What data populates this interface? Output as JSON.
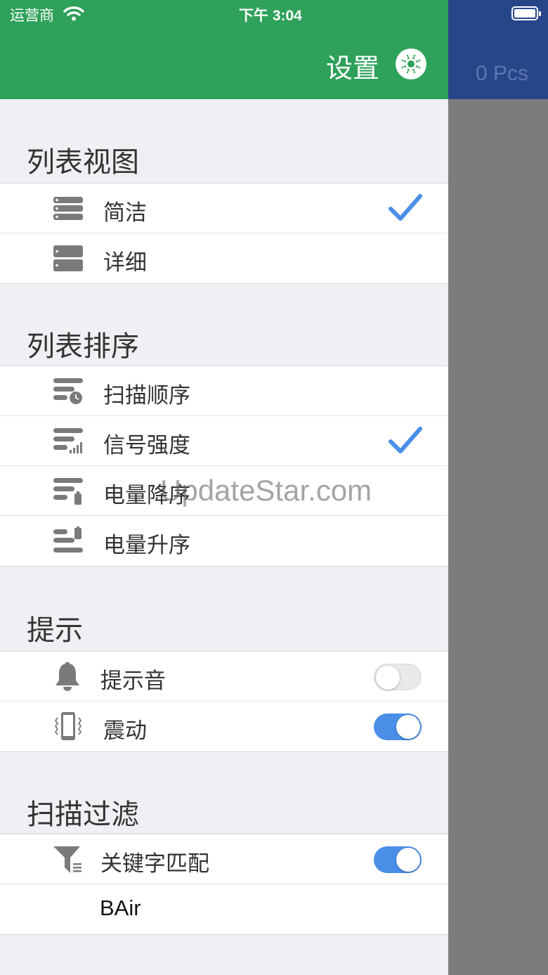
{
  "status_bar": {
    "carrier": "运营商",
    "time": "下午 3:04"
  },
  "header": {
    "title": "设置",
    "icon": "gear-icon",
    "color": "#2ea15a"
  },
  "background_panel": {
    "count_label": "0 Pcs",
    "color": "#27468a"
  },
  "sections": {
    "list_view": {
      "title": "列表视图",
      "items": [
        {
          "label": "简洁",
          "icon": "compact-list-icon",
          "checked": true
        },
        {
          "label": "详细",
          "icon": "detailed-list-icon",
          "checked": false
        }
      ]
    },
    "list_sort": {
      "title": "列表排序",
      "items": [
        {
          "label": "扫描顺序",
          "icon": "sort-scan-order-icon",
          "checked": false
        },
        {
          "label": "信号强度",
          "icon": "sort-signal-icon",
          "checked": true
        },
        {
          "label": "电量降序",
          "icon": "sort-battery-desc-icon",
          "checked": false
        },
        {
          "label": "电量升序",
          "icon": "sort-battery-asc-icon",
          "checked": false
        }
      ]
    },
    "alerts": {
      "title": "提示",
      "items": [
        {
          "label": "提示音",
          "icon": "bell-icon",
          "enabled": false
        },
        {
          "label": "震动",
          "icon": "vibrate-icon",
          "enabled": true
        }
      ]
    },
    "scan_filter": {
      "title": "扫描过滤",
      "items": [
        {
          "label": "关键字匹配",
          "icon": "filter-icon",
          "enabled": true
        }
      ],
      "keyword": "BAir"
    }
  },
  "watermark": "UpdateStar.com",
  "colors": {
    "accent": "#4a8ee8",
    "toggle_off": "#e9e9ec"
  }
}
